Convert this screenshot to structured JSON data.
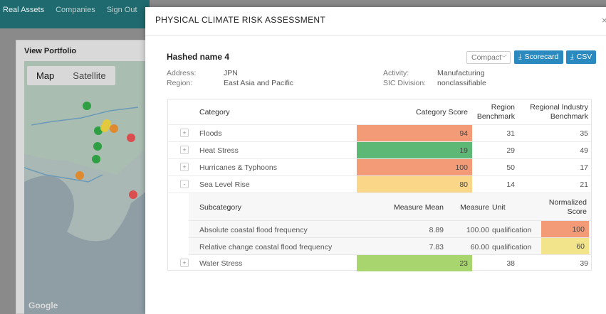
{
  "background": {
    "nav_items": [
      "Real Assets",
      "Companies",
      "Sign Out"
    ],
    "panel_title": "View Portfolio",
    "map_toggle": [
      "Map",
      "Satellite"
    ],
    "map_brand": "Google"
  },
  "modal": {
    "title": "PHYSICAL CLIMATE RISK ASSESSMENT",
    "close_glyph": "×",
    "asset_name": "Hashed name 4",
    "meta": {
      "address_label": "Address:",
      "address_value": "JPN",
      "region_label": "Region:",
      "region_value": "East Asia and Pacific",
      "activity_label": "Activity:",
      "activity_value": "Manufacturing",
      "sic_label": "SIC Division:",
      "sic_value": "nonclassifiable"
    },
    "view_select": "Compact",
    "scorecard_button": "Scorecard",
    "csv_button": "CSV"
  },
  "table": {
    "headers": {
      "category": "Category",
      "category_score": "Category Score",
      "region_benchmark_1": "Region",
      "region_benchmark_2": "Benchmark",
      "industry_benchmark_1": "Regional Industry",
      "industry_benchmark_2": "Benchmark"
    },
    "rows": [
      {
        "expander": "+",
        "category": "Floods",
        "score": "94",
        "region": "31",
        "industry": "35",
        "color": "#f39a77"
      },
      {
        "expander": "+",
        "category": "Heat Stress",
        "score": "19",
        "region": "29",
        "industry": "49",
        "color": "#5cb874"
      },
      {
        "expander": "+",
        "category": "Hurricanes & Typhoons",
        "score": "100",
        "region": "50",
        "industry": "17",
        "color": "#f39a77"
      },
      {
        "expander": "-",
        "category": "Sea Level Rise",
        "score": "80",
        "region": "14",
        "industry": "21",
        "color": "#fad688"
      },
      {
        "expander": "+",
        "category": "Water Stress",
        "score": "23",
        "region": "38",
        "industry": "39",
        "color": "#a9d56f"
      }
    ],
    "sub_headers": {
      "subcategory": "Subcategory",
      "measure_mean": "Measure Mean",
      "measure": "Measure",
      "unit": "Unit",
      "normalized_1": "Normalized",
      "normalized_2": "Score"
    },
    "sub_rows": [
      {
        "subcategory": "Absolute coastal flood frequency",
        "measure_mean": "8.89",
        "measure": "100.00",
        "unit": "qualification",
        "normalized": "100",
        "color": "#f39a77"
      },
      {
        "subcategory": "Relative change coastal flood frequency",
        "measure_mean": "7.83",
        "measure": "60.00",
        "unit": "qualification",
        "normalized": "60",
        "color": "#f1e48a"
      }
    ]
  }
}
